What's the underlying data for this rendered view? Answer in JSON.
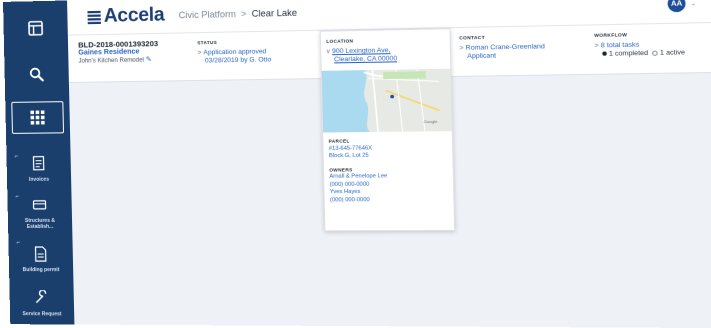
{
  "sidebar": {
    "items": [
      {
        "icon": "dashboard-icon",
        "label": ""
      },
      {
        "icon": "search-icon",
        "label": ""
      },
      {
        "icon": "apps-grid-icon",
        "label": ""
      },
      {
        "icon": "invoice-icon",
        "label": "Invoices"
      },
      {
        "icon": "structure-icon",
        "label": "Structures & Establish..."
      },
      {
        "icon": "building-permit-icon",
        "label": "Building permit"
      },
      {
        "icon": "service-request-icon",
        "label": "Service Request"
      }
    ]
  },
  "header": {
    "logo_text": "Accela",
    "breadcrumb": [
      "Civic Platform",
      "Clear Lake"
    ],
    "breadcrumb_sep": ">",
    "avatar_initials": "AA",
    "avatar_caret": "⌄"
  },
  "record": {
    "id": "BLD-2018-0001393203",
    "name": "Gaines Residence",
    "description": "John's Kitchen Remodel",
    "edit_icon": "✎"
  },
  "status": {
    "header": "STATUS",
    "line1": "Application approved",
    "line2": "03/28/2019 by G. Otto"
  },
  "location": {
    "header": "LOCATION",
    "address_line1": "900 Lexington Ave,",
    "address_line2": "Clearlake, CA 00000",
    "parcel_header": "PARCEL",
    "parcel_line1": "#13-645-77646X",
    "parcel_line2": "Block G, Lot 25",
    "owners_header": "OWNERS",
    "owner1_name": "Arnall & Penelope Lee",
    "owner1_phone": "(000) 000-0000",
    "owner2_name": "Yves Hayes",
    "owner2_phone": "(000) 000-0000"
  },
  "contact": {
    "header": "CONTACT",
    "name": "Roman Crane-Greenland",
    "role": "Applicant"
  },
  "workflow": {
    "header": "WORKFLOW",
    "tasks": "8 total tasks",
    "completed": "1 completed",
    "active": "1 active"
  },
  "colors": {
    "sidebar": "#1b3f6d",
    "brand": "#1d3e73",
    "link": "#2a66c4",
    "background": "#eef1f5"
  }
}
